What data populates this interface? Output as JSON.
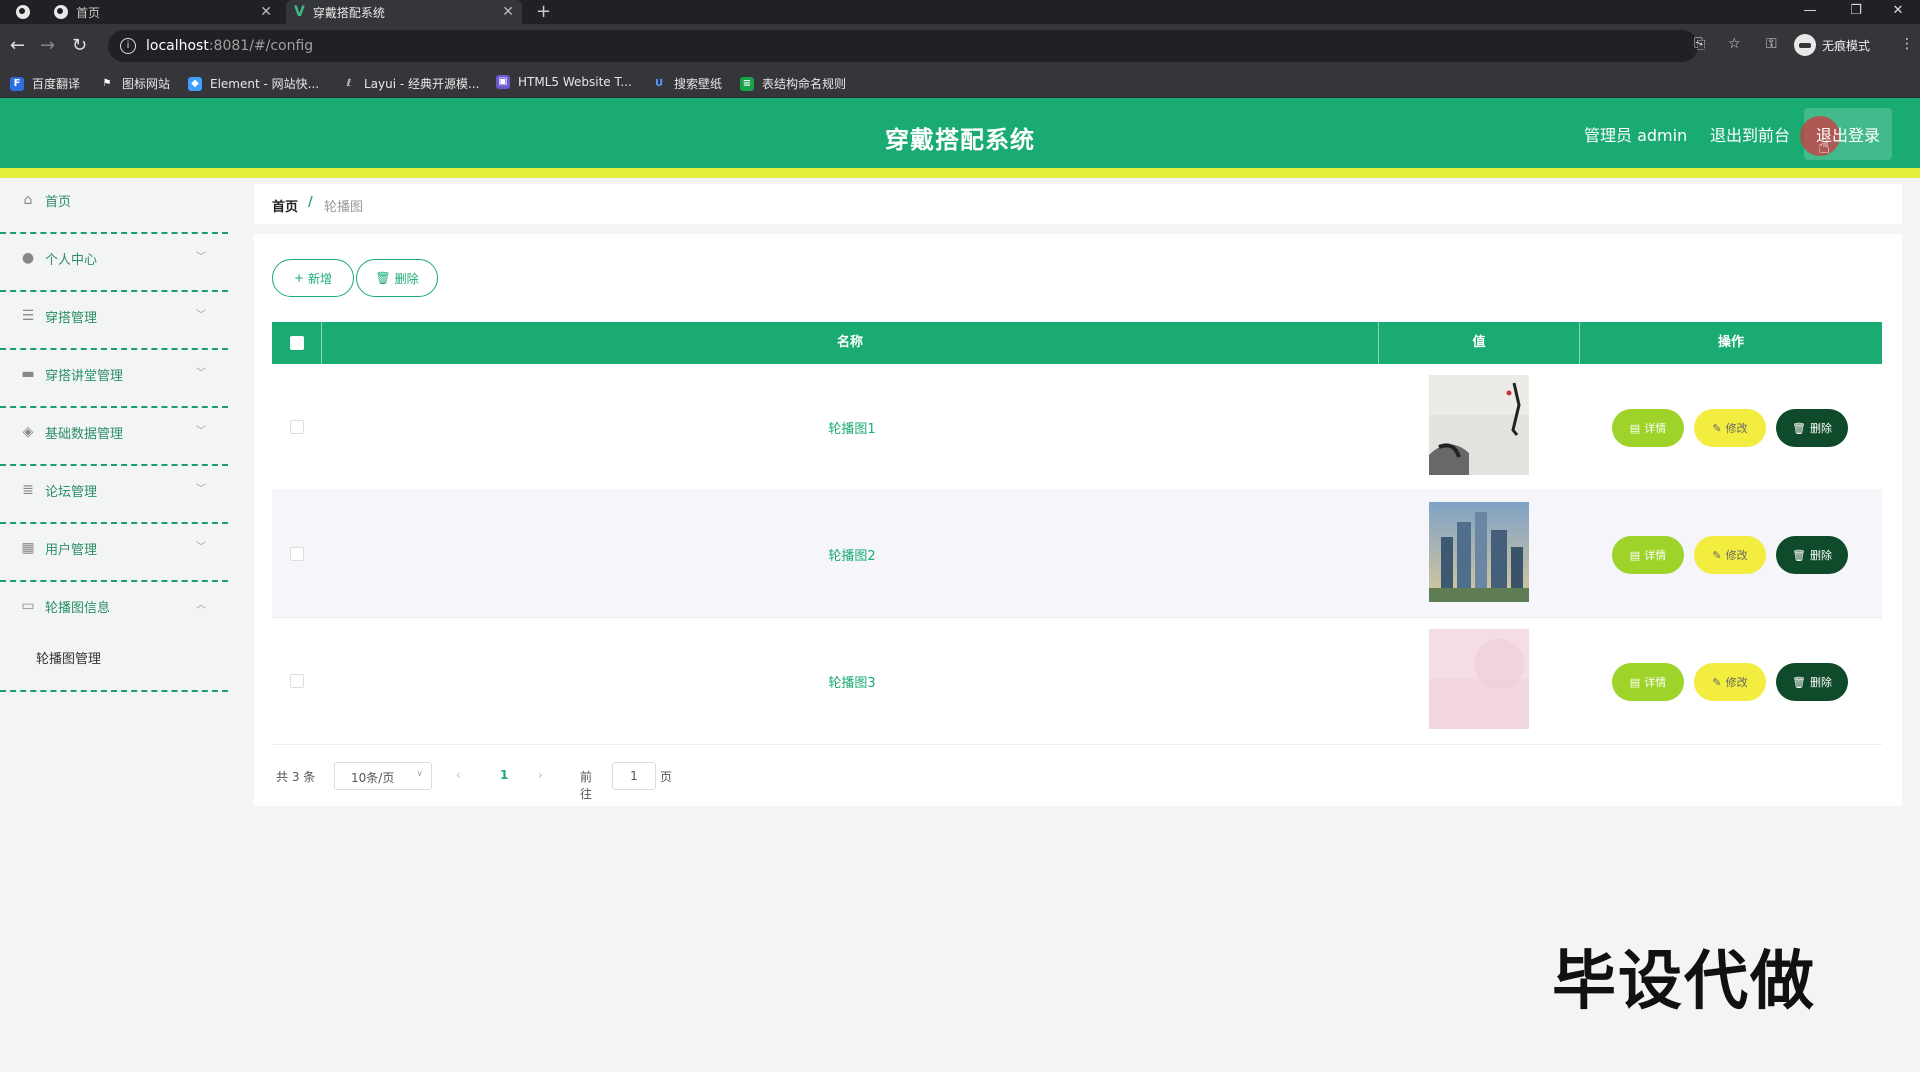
{
  "browser": {
    "tabs": [
      {
        "title": "首页"
      },
      {
        "title": "穿戴搭配系统"
      }
    ],
    "url_host": "localhost",
    "url_path": ":8081/#/config",
    "incognito_label": "无痕模式",
    "bookmarks": [
      {
        "label": "百度翻译",
        "color": "#2d6fe0"
      },
      {
        "label": "图标网站",
        "color": "#ffffff"
      },
      {
        "label": "Element - 网站快...",
        "color": "#409eff"
      },
      {
        "label": "Layui - 经典开源模...",
        "color": "#cccccc"
      },
      {
        "label": "HTML5 Website T...",
        "color": "#6a5acd"
      },
      {
        "label": "搜索壁纸",
        "color": "#3b82f6"
      },
      {
        "label": "表结构命名规则",
        "color": "#16a34a"
      }
    ]
  },
  "header": {
    "title": "穿戴搭配系统",
    "admin_label": "管理员 admin",
    "front_label": "退出到前台",
    "logout_label": "退出登录"
  },
  "sidebar": {
    "items": [
      {
        "label": "首页",
        "icon": "home-icon",
        "arrow": ""
      },
      {
        "label": "个人中心",
        "icon": "user-icon",
        "arrow": "﹀"
      },
      {
        "label": "穿搭管理",
        "icon": "menu-icon",
        "arrow": "﹀"
      },
      {
        "label": "穿搭讲堂管理",
        "icon": "chat-icon",
        "arrow": "﹀"
      },
      {
        "label": "基础数据管理",
        "icon": "leaf-icon",
        "arrow": "﹀"
      },
      {
        "label": "论坛管理",
        "icon": "list-icon",
        "arrow": "﹀"
      },
      {
        "label": "用户管理",
        "icon": "grid-icon",
        "arrow": "﹀"
      },
      {
        "label": "轮播图信息",
        "icon": "briefcase-icon",
        "arrow": "︿"
      }
    ],
    "submenu": {
      "label": "轮播图管理"
    }
  },
  "breadcrumb": {
    "home": "首页",
    "sep": "/",
    "current": "轮播图"
  },
  "toolbar": {
    "add_label": "新增",
    "delete_label": "删除"
  },
  "table": {
    "headers": {
      "name": "名称",
      "value": "值",
      "ops": "操作"
    },
    "rows": [
      {
        "name": "轮播图1",
        "thumb": "ink-painting"
      },
      {
        "name": "轮播图2",
        "thumb": "city-skyline"
      },
      {
        "name": "轮播图3",
        "thumb": "pink-texture"
      }
    ],
    "ops": {
      "detail": "详情",
      "edit": "修改",
      "delete": "删除"
    }
  },
  "pager": {
    "total": "共 3 条",
    "page_size": "10条/页",
    "current_page": "1",
    "goto_label": "前往",
    "goto_value": "1",
    "page_suffix": "页"
  },
  "watermark": "毕设代做",
  "colors": {
    "primary": "#1aab73",
    "stripe": "#e6f03c",
    "detail": "#9ed32a",
    "edit": "#f2ed3e",
    "delete": "#0f4a2a"
  }
}
